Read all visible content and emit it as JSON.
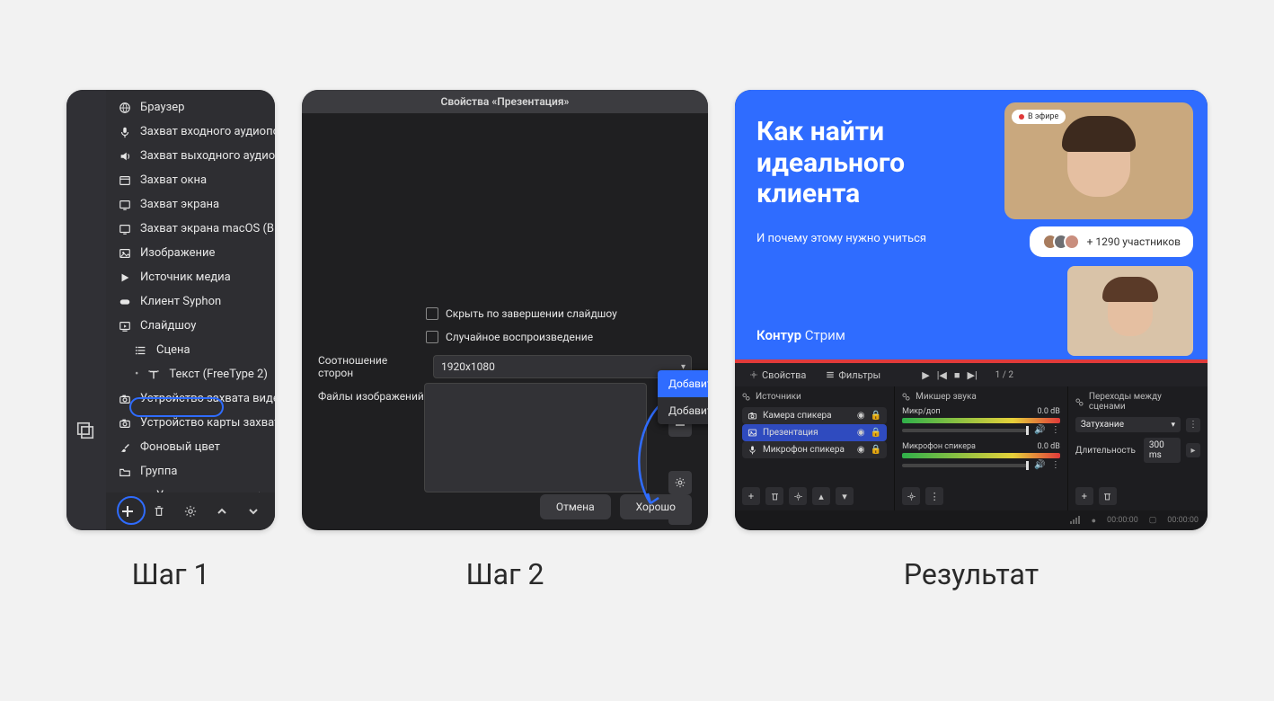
{
  "captions": {
    "step1": "Шаг 1",
    "step2": "Шаг 2",
    "result": "Результат"
  },
  "panel1": {
    "items": [
      {
        "label": "Браузер",
        "icon": "globe"
      },
      {
        "label": "Захват входного аудиопотока",
        "icon": "mic"
      },
      {
        "label": "Захват выходного аудиопотока",
        "icon": "speaker"
      },
      {
        "label": "Захват окна",
        "icon": "window"
      },
      {
        "label": "Захват экрана",
        "icon": "screen"
      },
      {
        "label": "Захват экрана macOS (BETA)",
        "icon": "screen"
      },
      {
        "label": "Изображение",
        "icon": "image"
      },
      {
        "label": "Источник медиа",
        "icon": "play"
      },
      {
        "label": "Клиент Syphon",
        "icon": "vr"
      },
      {
        "label": "Слайдшоу",
        "icon": "slideshow",
        "highlight": true
      },
      {
        "label": "Сцена",
        "icon": "list",
        "sub": true,
        "pre": "copy"
      },
      {
        "label": "Текст (FreeType 2)",
        "icon": "text",
        "sub": true,
        "pre": "dot"
      },
      {
        "label": "Устройство захвата видео",
        "icon": "camera"
      },
      {
        "label": "Устройство карты захвата",
        "icon": "camera"
      },
      {
        "label": "Фоновый цвет",
        "icon": "brush"
      },
      {
        "label": "Группа",
        "icon": "folder"
      },
      {
        "label": "Устаревшее",
        "icon": "",
        "chevron": true,
        "sub": true
      }
    ]
  },
  "panel2": {
    "title": "Свойства «Презентация»",
    "chk_hide": "Скрыть по завершении слайдшоу",
    "chk_random": "Случайное воспроизведение",
    "aspect_label": "Соотношение сторон",
    "aspect_value": "1920x1080",
    "files_label": "Файлы изображений",
    "popover": {
      "add_files": "Добавить файлы",
      "add_folder": "Добавить папку"
    },
    "btn_cancel": "Отмена",
    "btn_ok": "Хорошо"
  },
  "panel3": {
    "preview_title_l1": "Как найти",
    "preview_title_l2": "идеального",
    "preview_title_l3": "клиента",
    "preview_sub": "И почему этому нужно учиться",
    "brand1": "Контур",
    "brand2": "Стрим",
    "live_badge": "В эфире",
    "participants": "+ 1290 участников",
    "tabs": {
      "props": "Свойства",
      "filters": "Фильтры"
    },
    "pager": "1 / 2",
    "sources_hdr": "Источники",
    "sources": [
      {
        "label": "Камера спикера",
        "icon": "camera"
      },
      {
        "label": "Презентация",
        "icon": "image",
        "selected": true
      },
      {
        "label": "Микрофон спикера",
        "icon": "mic"
      }
    ],
    "mixer_hdr": "Микшер звука",
    "mixers": [
      {
        "name": "Микр/доп",
        "db": "0.0 dB"
      },
      {
        "name": "Микрофон спикера",
        "db": "0.0 dB"
      }
    ],
    "trans_hdr": "Переходы между сценами",
    "trans_type_label": "Затухание",
    "trans_dur_label": "Длительность",
    "trans_dur_value": "300 ms",
    "status_time": "00:00:00"
  }
}
